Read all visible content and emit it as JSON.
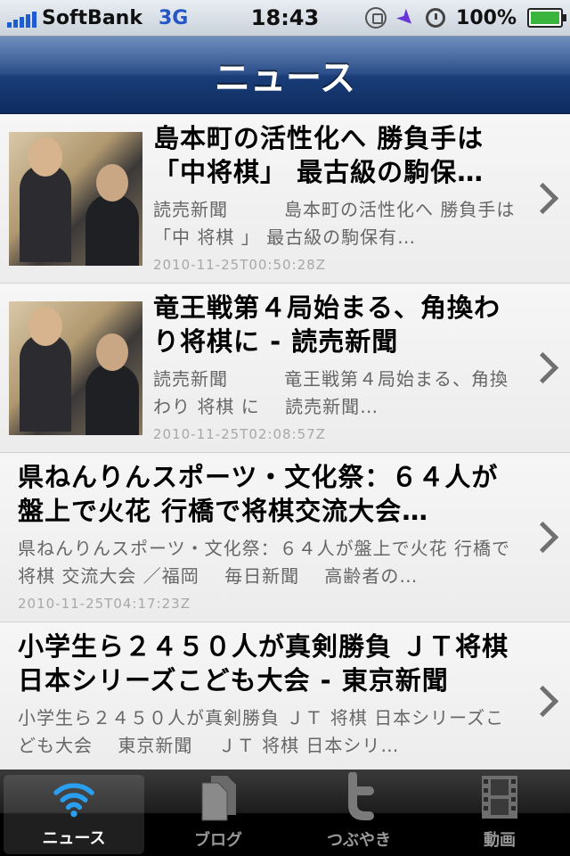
{
  "statusbar": {
    "carrier": "SoftBank",
    "network": "3G",
    "time": "18:43",
    "battery": "100%"
  },
  "navbar": {
    "title": "ニュース"
  },
  "articles": [
    {
      "title": "島本町の活性化へ 勝負手は「中将棋」 最古級の駒保…",
      "desc": "読売新聞　　　島本町の活性化へ 勝負手は「中 将棋 」 最古級の駒保有…",
      "date": "2010-11-25T00:50:28Z",
      "has_thumb": true
    },
    {
      "title": "竜王戦第４局始まる、角換わり将棋に - 読売新聞",
      "desc": "読売新聞　　　竜王戦第４局始まる、角換わり 将棋 に　 読売新聞…",
      "date": "2010-11-25T02:08:57Z",
      "has_thumb": true
    },
    {
      "title": "県ねんりんスポーツ・文化祭：６４人が盤上で火花 行橋で将棋交流大会…",
      "desc": "県ねんりんスポーツ・文化祭：６４人が盤上で火花 行橋で 将棋 交流大会 ／福岡　 毎日新聞　 高齢者の…",
      "date": "2010-11-25T04:17:23Z",
      "has_thumb": false
    },
    {
      "title": "小学生ら２４５０人が真剣勝負 ＪＴ将棋日本シリーズこども大会 - 東京新聞",
      "desc": "小学生ら２４５０人が真剣勝負 ＪＴ 将棋 日本シリーズこども大会　 東京新聞　 ＪＴ 将棋 日本シリ…",
      "date": "",
      "has_thumb": false
    }
  ],
  "tabs": [
    {
      "label": "ニュース",
      "icon": "wifi-icon",
      "active": true
    },
    {
      "label": "ブログ",
      "icon": "documents-icon",
      "active": false
    },
    {
      "label": "つぶやき",
      "icon": "twitter-icon",
      "active": false
    },
    {
      "label": "動画",
      "icon": "film-icon",
      "active": false
    }
  ],
  "colors": {
    "nav_bar": "#1a3d78",
    "tab_bar": "#000000",
    "chevron": "#707070"
  }
}
